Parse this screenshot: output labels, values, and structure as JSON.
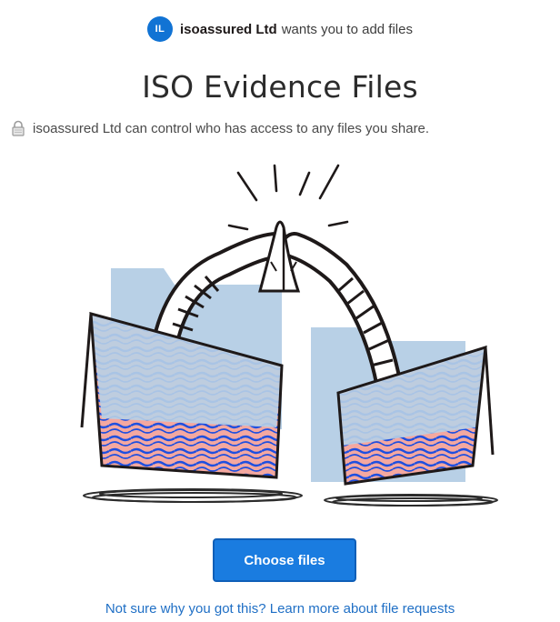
{
  "requester": {
    "avatar_initials": "IL",
    "name": "isoassured Ltd",
    "action_text": "wants you to add files"
  },
  "request": {
    "title": "ISO Evidence Files"
  },
  "privacy": {
    "icon": "lock-icon",
    "text": "isoassured Ltd can control who has access to any files you share."
  },
  "illustration": {
    "name": "folders-high-five-illustration"
  },
  "actions": {
    "choose_files_label": "Choose files"
  },
  "footer": {
    "help_link_text": "Not sure why you got this? Learn more about file requests"
  },
  "colors": {
    "accent": "#1a7ce0",
    "avatar": "#1173d4",
    "link": "#1f6fc5",
    "folder": "#b8d0e6",
    "pattern_pink": "#f4a8a0",
    "pattern_blue": "#1e4fe0"
  }
}
